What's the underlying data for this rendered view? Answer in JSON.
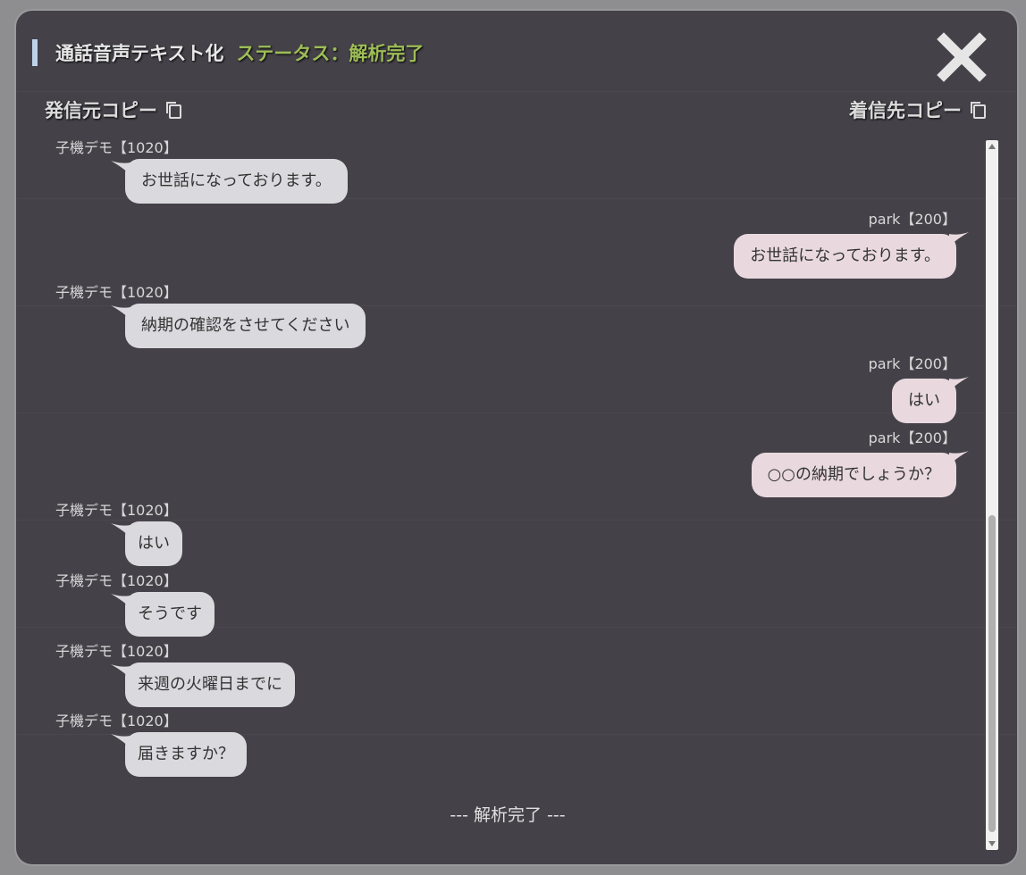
{
  "modal": {
    "title": "通話音声テキスト化",
    "status": "ステータス：解析完了",
    "copy_caller": "発信元コピー",
    "copy_callee": "着信先コピー",
    "close_icon": "close-icon",
    "copy_icon": "copy-icon"
  },
  "messages": [
    {
      "side": "left",
      "name": "子機デモ【1020】",
      "text": "お世話になっております。"
    },
    {
      "side": "right",
      "name": "park【200】",
      "text": "お世話になっております。"
    },
    {
      "side": "left",
      "name": "子機デモ【1020】",
      "text": "納期の確認をさせてください"
    },
    {
      "side": "right",
      "name": "park【200】",
      "text": "はい"
    },
    {
      "side": "right",
      "name": "park【200】",
      "text": "○○の納期でしょうか？"
    },
    {
      "side": "left",
      "name": "子機デモ【1020】",
      "text": "はい"
    },
    {
      "side": "left",
      "name": "子機デモ【1020】",
      "text": "そうです"
    },
    {
      "side": "left",
      "name": "子機デモ【1020】",
      "text": "来週の火曜日までに"
    },
    {
      "side": "left",
      "name": "子機デモ【1020】",
      "text": "届きますか？"
    }
  ],
  "end_marker": "--- 解析完了 ---",
  "colors": {
    "modal_bg": "#444148",
    "status_green": "#9dbd57",
    "bubble_left": "#dadade",
    "bubble_right": "#e9d9de"
  }
}
